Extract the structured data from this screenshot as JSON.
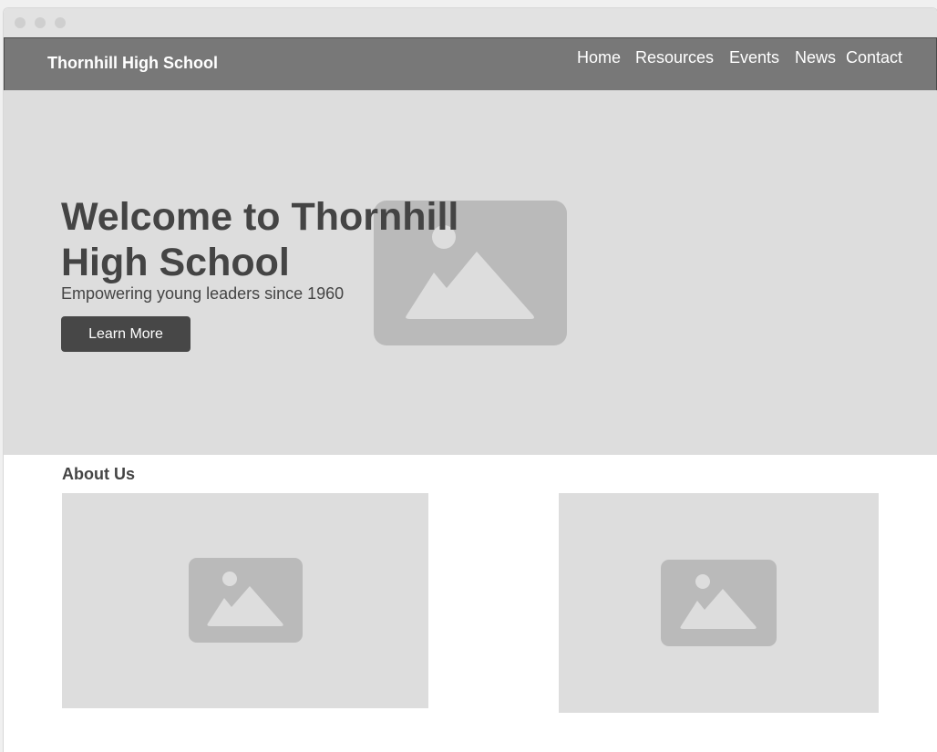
{
  "header": {
    "brand": "Thornhill High School",
    "nav": [
      "Home",
      "Resources",
      "Events",
      "News",
      "Contact"
    ]
  },
  "hero": {
    "title": "Welcome to Thornhill High School",
    "subtitle": "Empowering young leaders since 1960",
    "cta_label": "Learn More",
    "image_icon": "image-placeholder-icon"
  },
  "about": {
    "title": "About Us",
    "image_icons": [
      "image-placeholder-icon",
      "image-placeholder-icon"
    ]
  },
  "colors": {
    "navbar": "#787878",
    "hero_bg": "#dddddd",
    "button": "#474747",
    "text": "#444444",
    "placeholder": "#bababa"
  }
}
